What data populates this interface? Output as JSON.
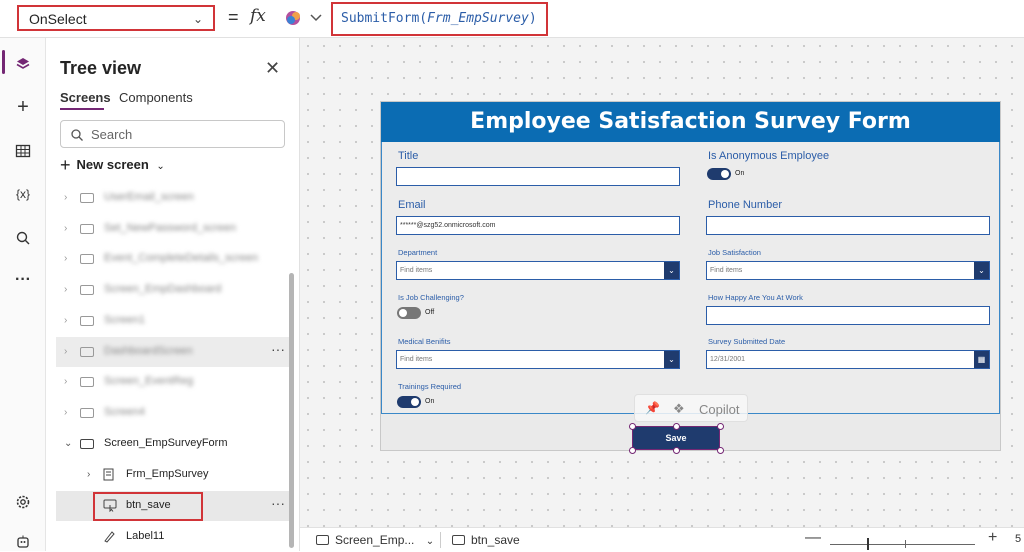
{
  "formula_bar": {
    "property": "OnSelect",
    "equals": "=",
    "fx": "fx",
    "formula_fn": "SubmitForm(",
    "formula_arg": "Frm_EmpSurvey",
    "formula_close": ")"
  },
  "left_rail": {
    "icons": [
      "layers-icon",
      "plus-icon",
      "table-icon",
      "variables-icon",
      "search-icon",
      "more-icon",
      "settings-icon",
      "bot-icon"
    ],
    "variables_text": "{x}",
    "more_text": "···"
  },
  "tree": {
    "title": "Tree view",
    "tabs": [
      "Screens",
      "Components"
    ],
    "search_placeholder": "Search",
    "new_screen": "New screen",
    "blurred_items": [
      "UserEmail_screen",
      "Set_NewPassword_screen",
      "Event_CompleteDetails_screen",
      "Screen_EmpDashboard",
      "Screen1",
      "DashboardScreen",
      "Screen_EventReg",
      "Screen4"
    ],
    "screen_item": "Screen_EmpSurveyForm",
    "form_item": "Frm_EmpSurvey",
    "selected_item": "btn_save",
    "label_item": "Label11"
  },
  "form": {
    "title": "Employee Satisfaction Survey Form",
    "fields": {
      "title_label": "Title",
      "anonymous_label": "Is Anonymous Employee",
      "anonymous_value": "On",
      "email_label": "Email",
      "email_value": "******@szg52.onmicrosoft.com",
      "phone_label": "Phone Number",
      "department_label": "Department",
      "department_placeholder": "Find items",
      "job_satisfaction_label": "Job Satisfaction",
      "job_satisfaction_placeholder": "Find items",
      "challenging_label": "Is Job Challenging?",
      "challenging_value": "Off",
      "happy_label": "How Happy Are You At Work",
      "benefits_label": "Medical Benifits",
      "benefits_placeholder": "Find items",
      "submitted_label": "Survey Submitted Date",
      "submitted_value": "12/31/2001",
      "trainings_label": "Trainings Required",
      "trainings_value": "On"
    },
    "save_label": "Save"
  },
  "copilot": {
    "label": "Copilot"
  },
  "bottom_bar": {
    "screen": "Screen_Emp...",
    "control": "btn_save",
    "zoom_minus": "—",
    "zoom_plus": "+",
    "zoom_value": "5"
  }
}
